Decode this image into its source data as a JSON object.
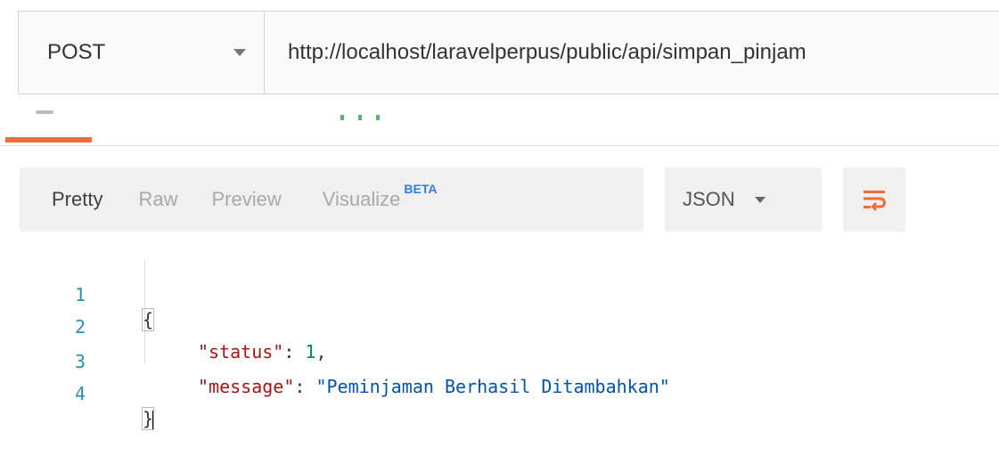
{
  "request": {
    "method": "POST",
    "url": "http://localhost/laravelperpus/public/api/simpan_pinjam"
  },
  "response_toolbar": {
    "view_tabs": [
      {
        "label": "Pretty",
        "active": true
      },
      {
        "label": "Raw",
        "active": false
      },
      {
        "label": "Preview",
        "active": false
      },
      {
        "label": "Visualize",
        "active": false,
        "badge": "BETA"
      }
    ],
    "format": "JSON",
    "wrap_icon": "wrap-lines-icon"
  },
  "editor": {
    "line_numbers": [
      "1",
      "2",
      "3",
      "4"
    ],
    "line1": {
      "text": "{"
    },
    "line2": {
      "key": "\"status\"",
      "colon": ": ",
      "value": "1",
      "comma": ","
    },
    "line3": {
      "key": "\"message\"",
      "colon": ": ",
      "value": "\"Peminjaman Berhasil Ditambahkan\""
    },
    "line4": {
      "text": "}"
    }
  },
  "colors": {
    "active_tab_underline": "#f26b3a",
    "beta_badge": "#2e7de1",
    "wrap_icon": "#f26b3a",
    "json_key": "#a31515",
    "json_number": "#098658",
    "json_string": "#0451a5",
    "line_number": "#2b91af"
  }
}
